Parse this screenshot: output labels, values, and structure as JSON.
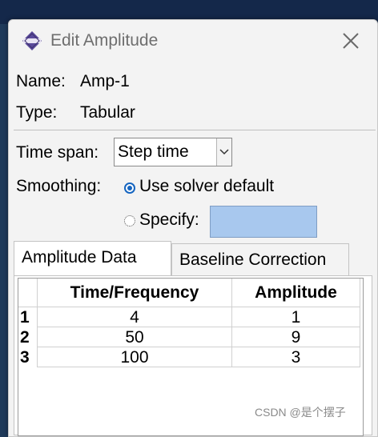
{
  "dialog": {
    "title": "Edit Amplitude",
    "name_label": "Name:",
    "name_value": "Amp-1",
    "type_label": "Type:",
    "type_value": "Tabular",
    "time_span_label": "Time span:",
    "time_span_value": "Step time",
    "smoothing_label": "Smoothing:",
    "smoothing_option1": "Use solver default",
    "smoothing_option2": "Specify:",
    "smoothing_specify_value": ""
  },
  "tabs": [
    {
      "label": "Amplitude Data",
      "active": true
    },
    {
      "label": "Baseline Correction",
      "active": false
    }
  ],
  "table": {
    "columns": [
      "Time/Frequency",
      "Amplitude"
    ],
    "row_numbers": [
      "1",
      "2",
      "3"
    ],
    "rows": [
      [
        "4",
        "1"
      ],
      [
        "50",
        "9"
      ],
      [
        "100",
        "3"
      ]
    ]
  },
  "watermark": "CSDN @是个摆子",
  "colors": {
    "specify_field": "#a8c8ee",
    "radio_selected": "#1565c0",
    "dialog_bg": "#f3f3f3"
  },
  "icons": {
    "app": "abaqus-diamond-icon",
    "close": "close-icon",
    "dropdown": "chevron-down-icon"
  }
}
